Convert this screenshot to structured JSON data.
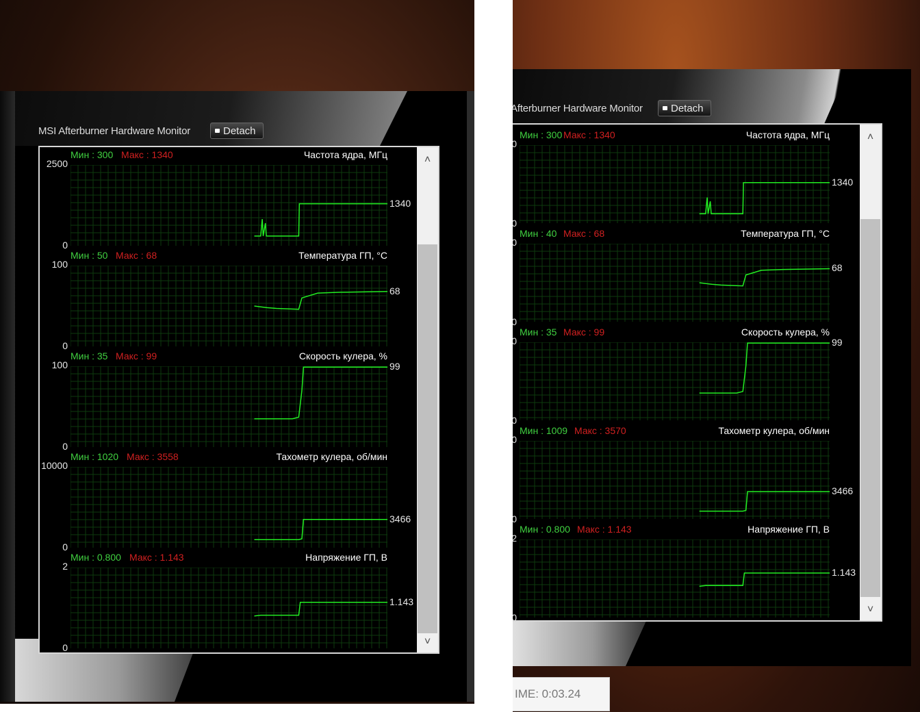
{
  "left_window": {
    "title": "MSI Afterburner Hardware Monitor",
    "detach_label": "Detach",
    "graphs": [
      {
        "min_text": "Мин : 300",
        "max_text": "Макс : 1340",
        "name": "Частота ядра, МГц",
        "y_top": "2500",
        "y_bottom": "0",
        "current": "1340"
      },
      {
        "min_text": "Мин : 50",
        "max_text": "Макс : 68",
        "name": "Температура ГП, °С",
        "y_top": "100",
        "y_bottom": "0",
        "current": "68"
      },
      {
        "min_text": "Мин : 35",
        "max_text": "Макс : 99",
        "name": "Скорость кулера, %",
        "y_top": "100",
        "y_bottom": "0",
        "current": "99"
      },
      {
        "min_text": "Мин : 1020",
        "max_text": "Макс : 3558",
        "name": "Тахометр кулера, об/мин",
        "y_top": "10000",
        "y_bottom": "0",
        "current": "3466"
      },
      {
        "min_text": "Мин : 0.800",
        "max_text": "Макс : 1.143",
        "name": "Напряжение ГП, В",
        "y_top": "2",
        "y_bottom": "0",
        "current": "1.143"
      }
    ]
  },
  "right_window": {
    "title": "Afterburner Hardware Monitor",
    "detach_label": "Detach",
    "graphs": [
      {
        "min_text": "Мин : 300",
        "max_text": "Макс : 1340",
        "name": "Частота ядра, МГц",
        "y_top": "0",
        "y_bottom": "0",
        "current": "1340"
      },
      {
        "min_text": "Мин : 40",
        "max_text": "Макс : 68",
        "name": "Температура ГП, °С",
        "y_top": "0",
        "y_bottom": "0",
        "current": "68"
      },
      {
        "min_text": "Мин : 35",
        "max_text": "Макс : 99",
        "name": "Скорость кулера, %",
        "y_top": "0",
        "y_bottom": "0",
        "current": "99"
      },
      {
        "min_text": "Мин : 1009",
        "max_text": "Макс : 3570",
        "name": "Тахометр кулера, об/мин",
        "y_top": "0",
        "y_bottom": "0",
        "current": "3466"
      },
      {
        "min_text": "Мин : 0.800",
        "max_text": "Макс : 1.143",
        "name": "Напряжение ГП, В",
        "y_top": "2",
        "y_bottom": "0",
        "current": "1.143"
      }
    ]
  },
  "timer_text": "IME: 0:03.24",
  "colors": {
    "min": "#40d040",
    "max": "#d02020",
    "line": "#22ee22",
    "grid": "#0e3a0e"
  },
  "icons": {
    "scroll_up": "chevron-up-icon",
    "scroll_down": "chevron-down-icon",
    "detach": "detach-icon"
  }
}
